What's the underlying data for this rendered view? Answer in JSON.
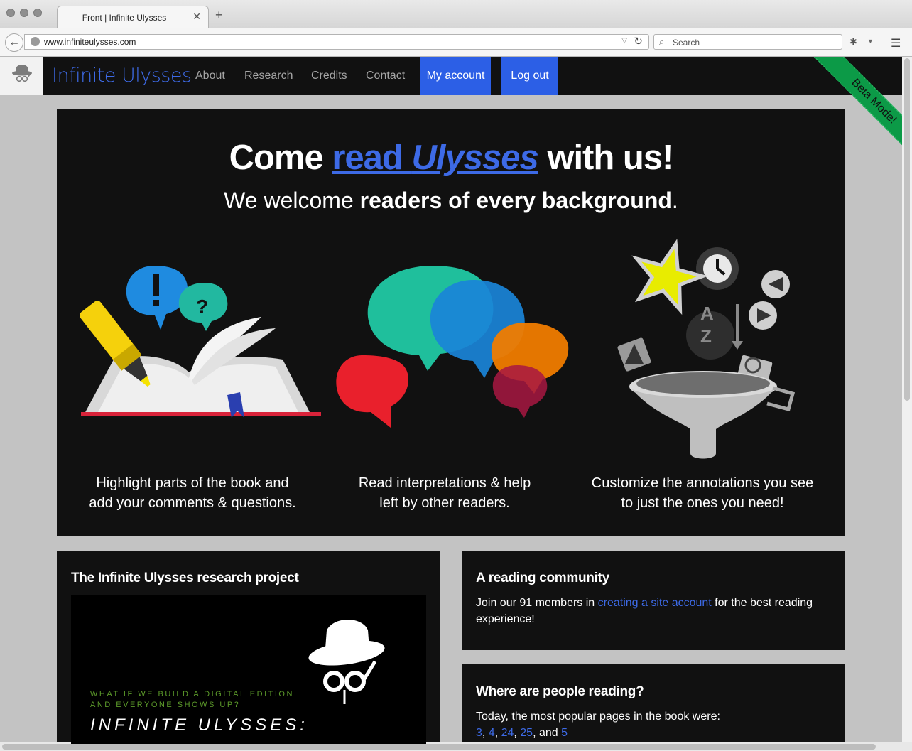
{
  "browser": {
    "tab_title": "Front | Infinite Ulysses",
    "url": "www.infiniteulysses.com",
    "search_placeholder": "Search"
  },
  "nav": {
    "brand": "Infinite Ulysses",
    "links": [
      "About",
      "Research",
      "Credits",
      "Contact"
    ],
    "my_account": "My account",
    "log_out": "Log out",
    "ribbon": "Beta Mode!"
  },
  "hero": {
    "title_pre": "Come ",
    "title_link_a": "read ",
    "title_link_b": "Ulysses",
    "title_post": " with us!",
    "sub_pre": "We welcome ",
    "sub_bold": "readers of every background",
    "sub_post": ".",
    "features": [
      {
        "line1": "Highlight parts of the book and",
        "line2": "add your comments & questions."
      },
      {
        "line1": "Read interpretations & help",
        "line2": "left by other readers."
      },
      {
        "line1": "Customize the annotations you see",
        "line2": "to just the ones you need!"
      }
    ]
  },
  "research": {
    "title": "The Infinite Ulysses research project",
    "video_line1": "WHAT IF WE BUILD A DIGITAL EDITION",
    "video_line2": "AND EVERYONE SHOWS UP?",
    "video_title": "INFINITE ULYSSES:"
  },
  "community": {
    "title": "A reading community",
    "text_pre": "Join our 91 members in ",
    "link": "creating a site account",
    "text_post": " for the best reading experience!"
  },
  "reading": {
    "title": "Where are people reading?",
    "text": "Today, the most popular pages in the book were:",
    "pages": [
      "3",
      "4",
      "24",
      "25"
    ],
    "and": ", and ",
    "last_page": "5"
  },
  "colors": {
    "accent": "#2c5fe6",
    "link": "#3d6ae6",
    "ribbon": "#0c9a47",
    "panel": "#111111"
  }
}
